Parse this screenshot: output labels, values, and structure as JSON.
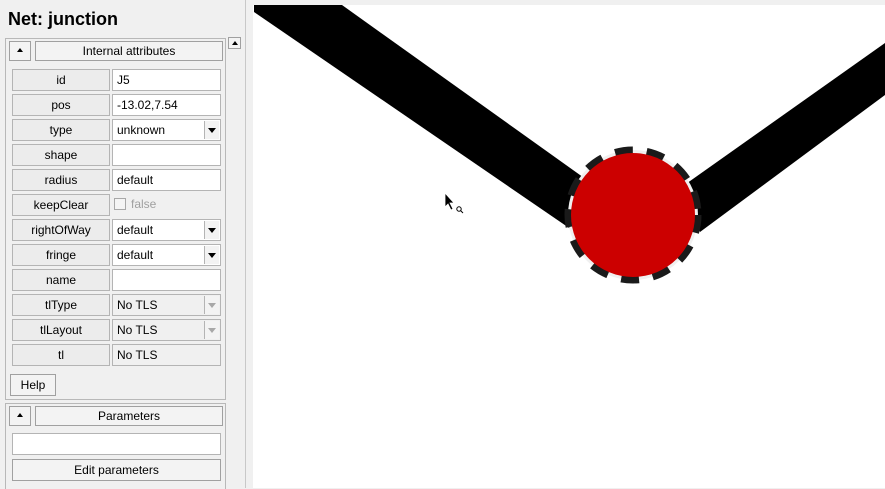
{
  "panel": {
    "title": "Net: junction",
    "internal_attributes": {
      "header": "Internal attributes",
      "rows": [
        {
          "label": "id",
          "value": "J5"
        },
        {
          "label": "pos",
          "value": "-13.02,7.54"
        },
        {
          "label": "type",
          "value": "unknown"
        },
        {
          "label": "shape",
          "value": ""
        },
        {
          "label": "radius",
          "value": "default"
        },
        {
          "label": "keepClear",
          "value": "false"
        },
        {
          "label": "rightOfWay",
          "value": "default"
        },
        {
          "label": "fringe",
          "value": "default"
        },
        {
          "label": "name",
          "value": ""
        },
        {
          "label": "tlType",
          "value": "No TLS"
        },
        {
          "label": "tlLayout",
          "value": "No TLS"
        },
        {
          "label": "tl",
          "value": "No TLS"
        }
      ],
      "help_label": "Help"
    },
    "parameters": {
      "header": "Parameters",
      "input_value": "",
      "edit_label": "Edit parameters"
    }
  },
  "canvas": {
    "background": "#ffffff",
    "road_color": "#000000",
    "junction_color": "#cc0000",
    "icons": [
      "mouse-pointer-icon"
    ]
  }
}
